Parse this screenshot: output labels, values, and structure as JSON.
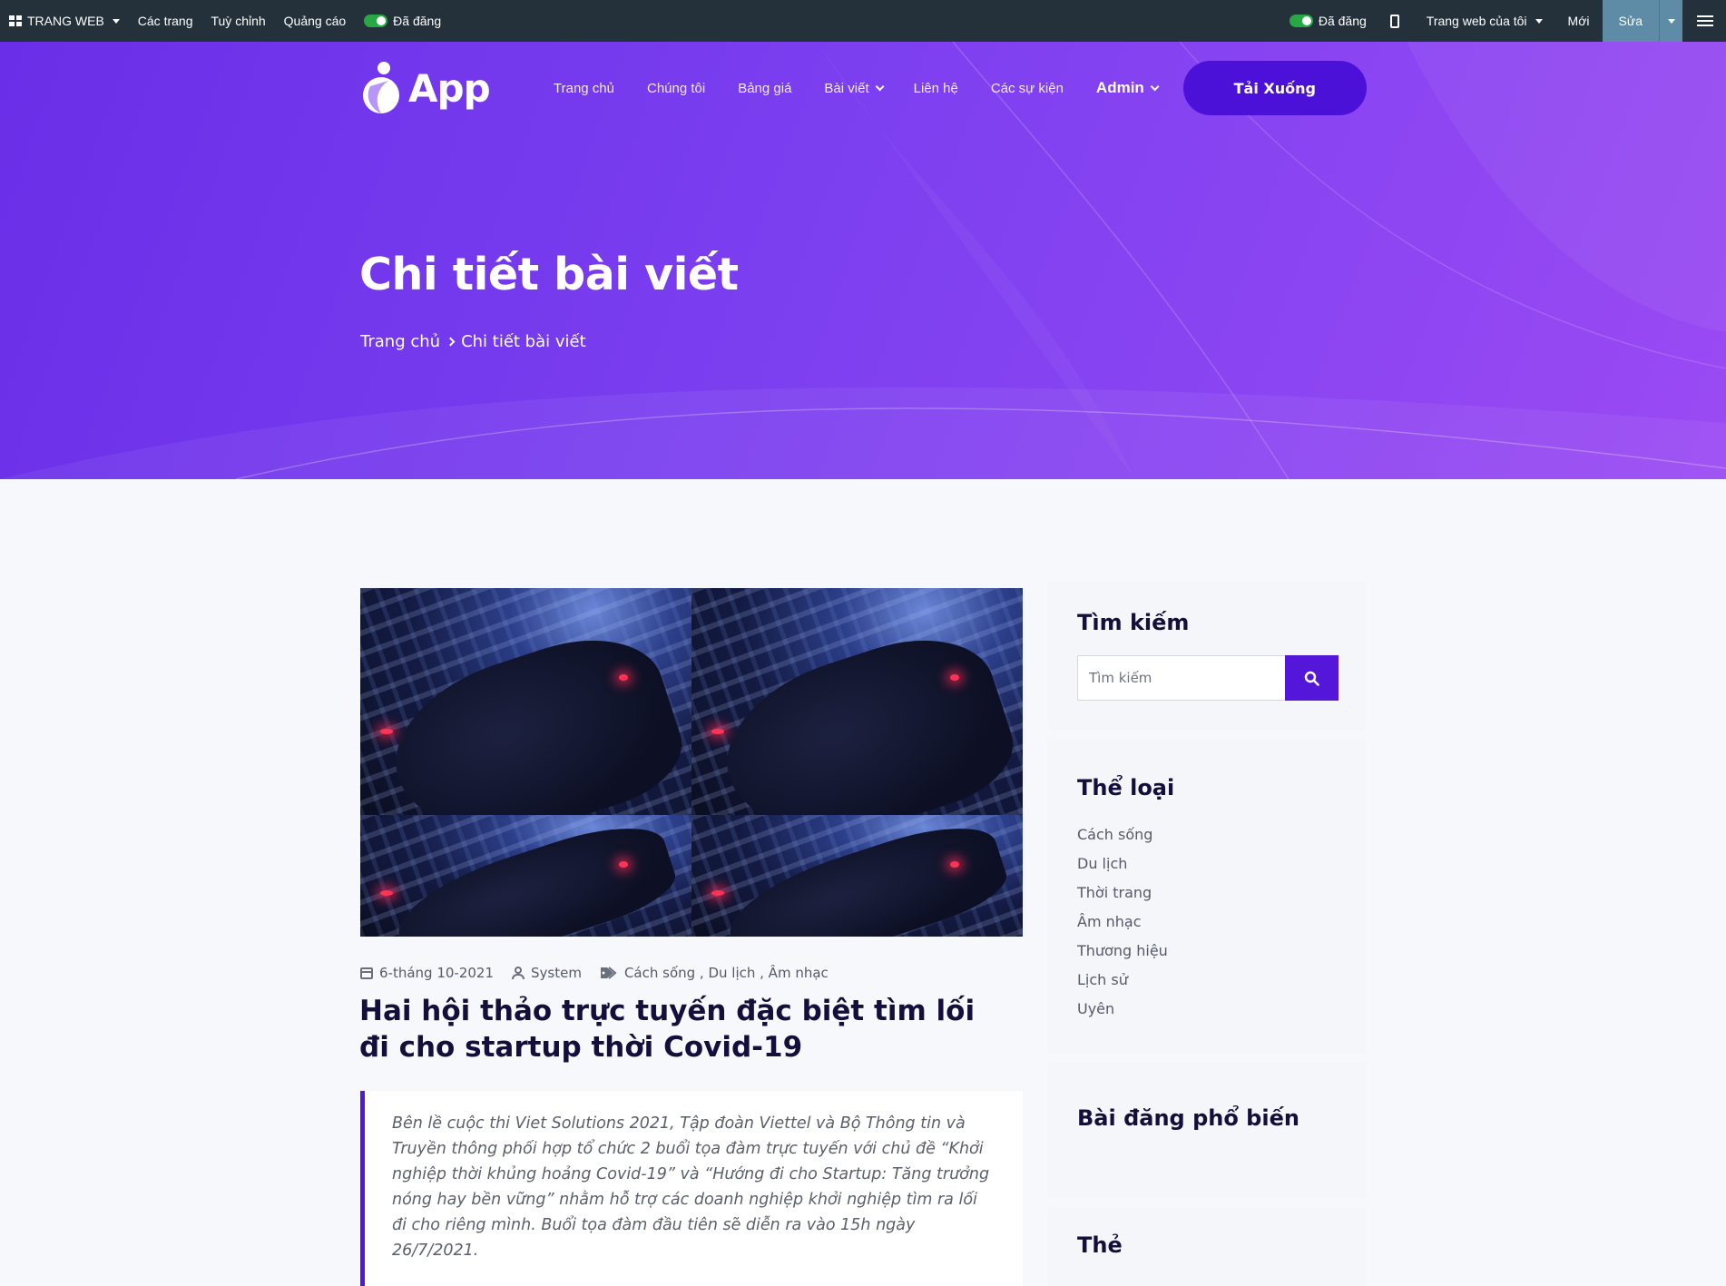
{
  "adminbar": {
    "site_label": "TRANG WEB",
    "pages": "Các trang",
    "customize": "Tuỳ chỉnh",
    "ads": "Quảng cáo",
    "published_left": "Đã đăng",
    "published_right": "Đã đăng",
    "my_site": "Trang web của tôi",
    "new": "Mới",
    "edit": "Sửa"
  },
  "nav": {
    "logo": "App",
    "items": [
      "Trang chủ",
      "Chúng tôi",
      "Bảng giá",
      "Bài viết",
      "Liên hệ",
      "Các sự kiện"
    ],
    "admin": "Admin",
    "download": "Tải Xuống"
  },
  "hero": {
    "title": "Chi tiết bài viết",
    "breadcrumb": [
      "Trang chủ",
      "Chi tiết bài viết"
    ]
  },
  "post": {
    "date": "6-tháng 10-2021",
    "author": "System",
    "categories": "Cách sống , Du lịch , Âm nhạc",
    "title": "Hai hội thảo trực tuyến đặc biệt tìm lối đi cho startup thời Covid-19",
    "quote": "Bên lề cuộc thi Viet Solutions 2021, Tập đoàn Viettel và Bộ Thông tin và Truyền thông phối hợp tổ chức 2 buổi tọa đàm trực tuyến với chủ đề “Khởi nghiệp thời khủng hoảng Covid-19” và “Hướng đi cho Startup: Tăng trưởng nóng hay bền vững” nhằm hỗ trợ các doanh nghiệp khởi nghiệp tìm ra lối đi cho riêng mình. Buổi tọa đàm đầu tiên sẽ diễn ra vào 15h ngày 26/7/2021."
  },
  "sidebar": {
    "search_title": "Tìm kiếm",
    "search_placeholder": "Tìm kiếm",
    "categories_title": "Thể loại",
    "categories": [
      "Cách sống",
      "Du lịch",
      "Thời trang",
      "Âm nhạc",
      "Thương hiệu",
      "Lịch sử",
      "Uyên"
    ],
    "popular_title": "Bài đăng phổ biến",
    "tags_title": "Thẻ"
  },
  "colors": {
    "accent": "#5417d9",
    "hero_start": "#6a2ee8",
    "hero_end": "#9a4af3",
    "adminbar": "#24303a"
  }
}
